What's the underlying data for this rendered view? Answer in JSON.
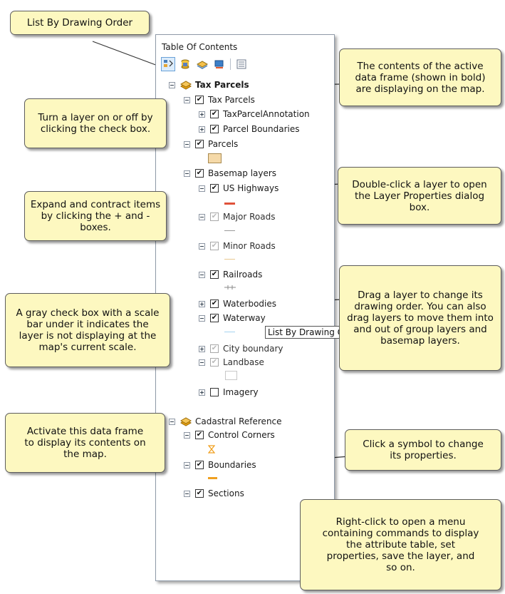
{
  "toc": {
    "title": "Table Of Contents",
    "toolbar": [
      {
        "name": "list-by-drawing-order",
        "icon": "list-drawing-order-icon",
        "active": true
      },
      {
        "name": "list-by-source",
        "icon": "database-icon"
      },
      {
        "name": "list-by-visibility",
        "icon": "layers-visibility-icon"
      },
      {
        "name": "list-by-selection",
        "icon": "selection-icon"
      },
      {
        "name": "options",
        "icon": "options-icon"
      }
    ],
    "tree": {
      "tax_parcels_frame": "Tax Parcels",
      "tax_parcels_group": "Tax Parcels",
      "tax_parcel_annotation": "TaxParcelAnnotation",
      "parcel_boundaries": "Parcel Boundaries",
      "parcels": "Parcels",
      "basemap_layers": "Basemap layers",
      "us_highways": "US Highways",
      "major_roads": "Major Roads",
      "minor_roads": "Minor Roads",
      "railroads": "Railroads",
      "waterbodies": "Waterbodies",
      "waterway": "Waterway",
      "city_boundary": "City boundary",
      "landbase": "Landbase",
      "imagery": "Imagery",
      "cadastral_frame": "Cadastral Reference",
      "control_corners": "Control Corners",
      "boundaries": "Boundaries",
      "sections": "Sections"
    },
    "tooltip": "List By Drawing Order"
  },
  "callouts": {
    "list_by_drawing_order": "List By Drawing Order",
    "active_frame": "The contents of the active data frame (shown in bold) are displaying on the map.",
    "turn_on_off": "Turn a layer on or off by clicking the check box.",
    "double_click": "Double-click a layer to open the Layer Properties dialog box.",
    "expand_contract": "Expand and contract items by clicking the + and - boxes.",
    "drag_layer": "Drag a layer to change its drawing order. You can also drag layers to move them into and out of group layers and basemap layers.",
    "gray_check": "A gray check box with a scale bar under it indicates the layer is not displaying at the map's current scale.",
    "activate_frame": "Activate this data frame to display its contents on the map.",
    "click_symbol": "Click a symbol to change its properties.",
    "right_click": "Right-click to open a menu containing commands to display the attribute table, set properties, save the layer, and so on."
  },
  "colors": {
    "callout_bg": "#fdf8c0",
    "highway_symbol": "#e0523a",
    "parcel_fill": "#f5d9a8",
    "minor_road_symbol": "#e8c890",
    "waterway_symbol": "#a6d4f0",
    "boundaries_symbol": "#f0a020",
    "data_frame_icon": "#e8a317"
  }
}
